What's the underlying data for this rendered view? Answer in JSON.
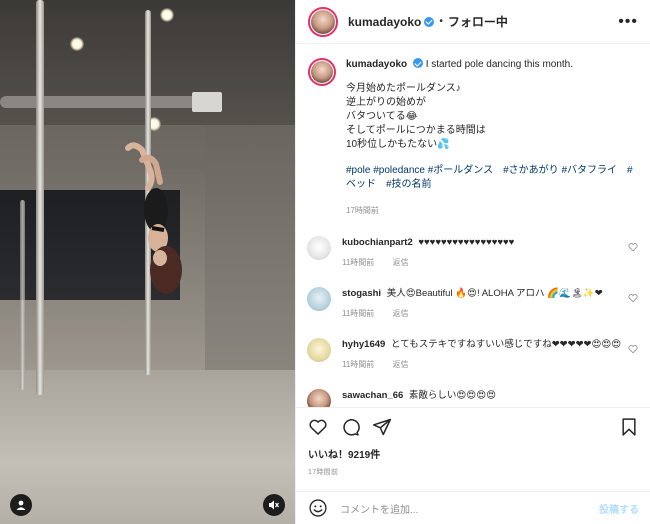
{
  "header": {
    "username": "kumadayoko",
    "separator": "•",
    "follow_label": "フォロー中",
    "more_label": "•••"
  },
  "caption": {
    "username": "kumadayoko",
    "first_line": "I started pole dancing this month.",
    "lines": [
      "今月始めたポールダンス♪",
      "逆上がりの始めが",
      "バタついてる😂",
      "そしてポールにつかまる時間は",
      "10秒位しかもたない💦"
    ],
    "hashtags": "#pole #poledance #ポールダンス　#さかあがり #バタフライ　#ベッド　#技の名前",
    "age": "17時間前"
  },
  "comments": [
    {
      "username": "kubochianpart2",
      "text": "♥♥♥♥♥♥♥♥♥♥♥♥♥♥♥♥♥",
      "age": "11時間前",
      "reply": "返信"
    },
    {
      "username": "stogashi",
      "text": "美人😍Beautiful 🔥😍! ALOHA アロハ 🌈🌊🏝✨❤",
      "age": "11時間前",
      "reply": "返信"
    },
    {
      "username": "hyhy1649",
      "text": "とてもステキですねすいい感じですね❤❤❤❤❤😍😍😍",
      "age": "11時間前",
      "reply": "返信"
    },
    {
      "username": "sawachan_66",
      "text": "素敵らしい😍😍😍😍",
      "age": "",
      "reply": ""
    }
  ],
  "actions": {
    "likes": "いいね！9219件",
    "timestamp": "17時間前"
  },
  "add_comment": {
    "placeholder": "コメントを追加...",
    "post_label": "投稿する"
  },
  "colors": {
    "verified": "#3897f0",
    "link": "#00376b",
    "post_disabled": "#b2dffc",
    "muted": "#8e8e8e"
  },
  "icons": [
    "heart-icon",
    "comment-icon",
    "share-icon",
    "bookmark-icon",
    "smile-icon",
    "user-icon",
    "mute-icon",
    "verified-icon"
  ]
}
